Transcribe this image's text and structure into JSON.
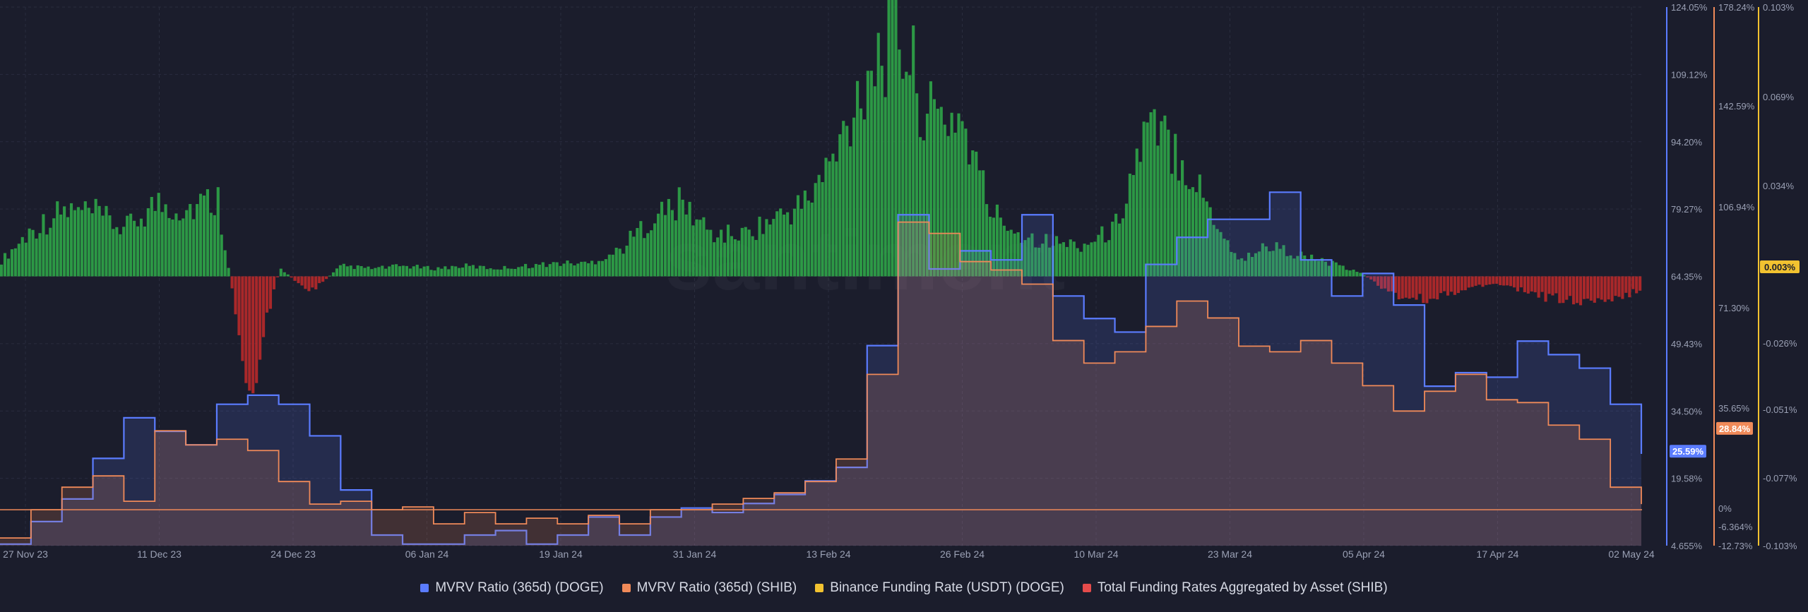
{
  "watermark": "santiment",
  "colors": {
    "background": "#1b1d2c",
    "doge_mvrv": "#5b7cff",
    "shib_mvrv": "#f08a59",
    "binance_funding": "#f2c230",
    "total_funding": "#e54b4b",
    "funding_positive": "#2fae4a",
    "funding_negative": "#c22a2a",
    "grid": "#2a2d3e"
  },
  "chart_data": {
    "type": "line",
    "title": "",
    "x": [
      "27 Nov 23",
      "11 Dec 23",
      "24 Dec 23",
      "06 Jan 24",
      "19 Jan 24",
      "31 Jan 24",
      "13 Feb 24",
      "26 Feb 24",
      "10 Mar 24",
      "23 Mar 24",
      "05 Apr 24",
      "17 Apr 24",
      "02 May 24"
    ],
    "axes": {
      "doge_mvrv": {
        "ticks": [
          "124.05%",
          "109.12%",
          "94.20%",
          "79.27%",
          "64.35%",
          "49.43%",
          "34.50%",
          "19.58%",
          "4.655%"
        ],
        "range": [
          4.655,
          124.05
        ],
        "current_label": "25.59%"
      },
      "shib_mvrv": {
        "ticks": [
          "178.24%",
          "142.59%",
          "106.94%",
          "71.30%",
          "35.65%",
          "0%",
          "-6.364%",
          "-12.73%"
        ],
        "range": [
          -12.73,
          178.24
        ],
        "current_label": "28.84%"
      },
      "funding": {
        "ticks": [
          "0.103%",
          "0.069%",
          "0.034%",
          "0.003%",
          "-0.026%",
          "-0.051%",
          "-0.077%",
          "-0.103%"
        ],
        "range": [
          -0.103,
          0.103
        ],
        "current_label": "0.003%"
      }
    },
    "series": [
      {
        "name": "MVRV Ratio (365d) (DOGE)",
        "axis": "doge_mvrv",
        "values": [
          5,
          10,
          15,
          24,
          33,
          30,
          27,
          36,
          38,
          36,
          29,
          17,
          7,
          5,
          5,
          7,
          8,
          5,
          7,
          11,
          7,
          11,
          13,
          12,
          14,
          16,
          19,
          22,
          49,
          78,
          66,
          70,
          68,
          78,
          60,
          55,
          52,
          67,
          73,
          77,
          77,
          83,
          68,
          60,
          65,
          58,
          40,
          43,
          42,
          50,
          47,
          44,
          36,
          25
        ]
      },
      {
        "name": "MVRV Ratio (365d) (SHIB)",
        "axis": "shib_mvrv",
        "values": [
          -10,
          0,
          8,
          12,
          3,
          28,
          23,
          25,
          21,
          10,
          2,
          3,
          0,
          1,
          -5,
          -1,
          -5,
          -3,
          -5,
          -2,
          -5,
          0,
          0,
          2,
          4,
          6,
          10,
          18,
          48,
          102,
          98,
          88,
          85,
          80,
          60,
          52,
          56,
          65,
          74,
          68,
          58,
          56,
          60,
          52,
          44,
          35,
          42,
          48,
          39,
          38,
          30,
          25,
          8,
          2
        ]
      },
      {
        "name": "Binance Funding Rate (USDT) (DOGE)",
        "axis": "funding",
        "values": [
          0.008,
          0.02,
          0.03,
          0.025,
          0.02,
          0.03,
          0.028,
          0.034,
          0.012,
          0.004,
          0.008,
          0.006,
          0.004,
          0.006,
          0.004,
          0.005,
          0.004,
          0.004,
          0.006,
          0.006,
          0.012,
          0.026,
          0.03,
          0.018,
          0.018,
          0.025,
          0.03,
          0.05,
          0.085,
          0.1,
          0.062,
          0.064,
          0.028,
          0.018,
          0.014,
          0.013,
          0.02,
          0.06,
          0.055,
          0.03,
          0.008,
          0.013,
          0.01,
          0.006,
          0.002,
          -0.004,
          -0.006,
          -0.004,
          -0.002,
          -0.004,
          -0.006,
          -0.008,
          -0.006,
          -0.004
        ]
      },
      {
        "name": "Total Funding Rates Aggregated by Asset (SHIB)",
        "axis": "funding",
        "values": [
          0.006,
          0.018,
          0.025,
          0.024,
          0.018,
          0.028,
          0.026,
          0.03,
          -0.045,
          0.003,
          -0.006,
          0.004,
          0.003,
          0.004,
          0.003,
          0.004,
          0.003,
          0.004,
          0.005,
          0.005,
          0.01,
          0.022,
          0.028,
          0.016,
          0.016,
          0.022,
          0.028,
          0.046,
          0.08,
          0.095,
          0.06,
          0.062,
          0.025,
          0.016,
          0.013,
          0.012,
          0.018,
          0.055,
          0.05,
          0.028,
          0.006,
          0.012,
          0.008,
          0.005,
          0.001,
          -0.007,
          -0.009,
          -0.006,
          -0.003,
          -0.005,
          -0.008,
          -0.01,
          -0.008,
          -0.006
        ]
      }
    ],
    "grid": true,
    "legend_position": "bottom-center"
  }
}
